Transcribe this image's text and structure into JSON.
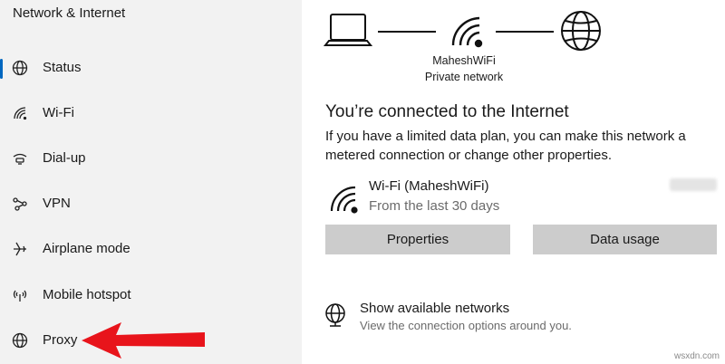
{
  "sidebar": {
    "title": "Network & Internet",
    "items": [
      {
        "label": "Status",
        "icon": "globe-icon",
        "active": true
      },
      {
        "label": "Wi-Fi",
        "icon": "wifi-icon"
      },
      {
        "label": "Dial-up",
        "icon": "dialup-icon"
      },
      {
        "label": "VPN",
        "icon": "vpn-icon"
      },
      {
        "label": "Airplane mode",
        "icon": "airplane-icon"
      },
      {
        "label": "Mobile hotspot",
        "icon": "hotspot-icon"
      },
      {
        "label": "Proxy",
        "icon": "globe-icon"
      }
    ]
  },
  "network": {
    "name": "MaheshWiFi",
    "type": "Private network"
  },
  "status": {
    "heading": "You’re connected to the Internet",
    "description": "If you have a limited data plan, you can make this network a metered connection or change other properties."
  },
  "connection": {
    "name": "Wi-Fi (MaheshWiFi)",
    "subtitle": "From the last 30 days"
  },
  "buttons": {
    "properties": "Properties",
    "data_usage": "Data usage"
  },
  "available": {
    "title": "Show available networks",
    "subtitle": "View the connection options around you."
  },
  "watermark": "wsxdn.com",
  "colors": {
    "accent": "#0067c0",
    "arrow": "#e8141b"
  }
}
